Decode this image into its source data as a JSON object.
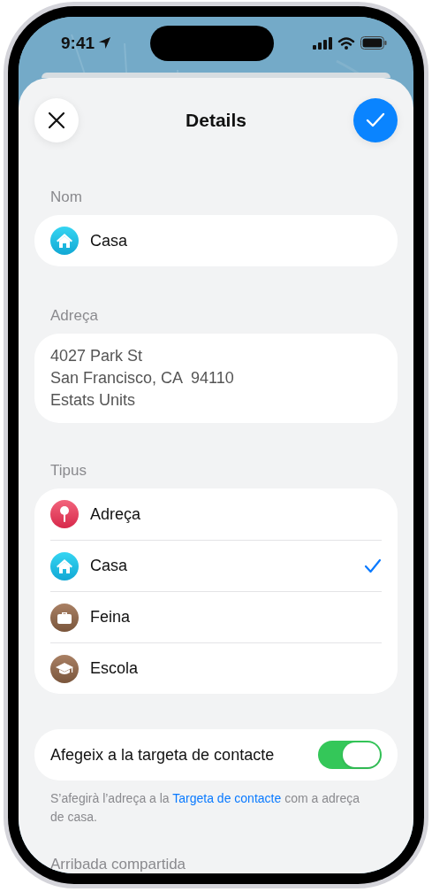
{
  "status_bar": {
    "time": "9:41"
  },
  "header": {
    "title": "Details"
  },
  "name_section": {
    "label": "Nom",
    "value": "Casa",
    "kind": "home"
  },
  "address_section": {
    "label": "Adreça",
    "lines": [
      "4027 Park St",
      "San Francisco, CA  94110",
      "Estats Units"
    ]
  },
  "type_section": {
    "label": "Tipus",
    "items": [
      {
        "label": "Adreça",
        "kind": "pin",
        "selected": false
      },
      {
        "label": "Casa",
        "kind": "home",
        "selected": true
      },
      {
        "label": "Feina",
        "kind": "work",
        "selected": false
      },
      {
        "label": "Escola",
        "kind": "school",
        "selected": false
      }
    ]
  },
  "contact_toggle": {
    "label": "Afegeix a la targeta de contacte",
    "on": true
  },
  "note": {
    "before": "S’afegirà l’adreça a la ",
    "link": "Targeta de contacte",
    "after": " com a adreça de casa."
  },
  "next_section": {
    "label": "Arribada compartida"
  }
}
